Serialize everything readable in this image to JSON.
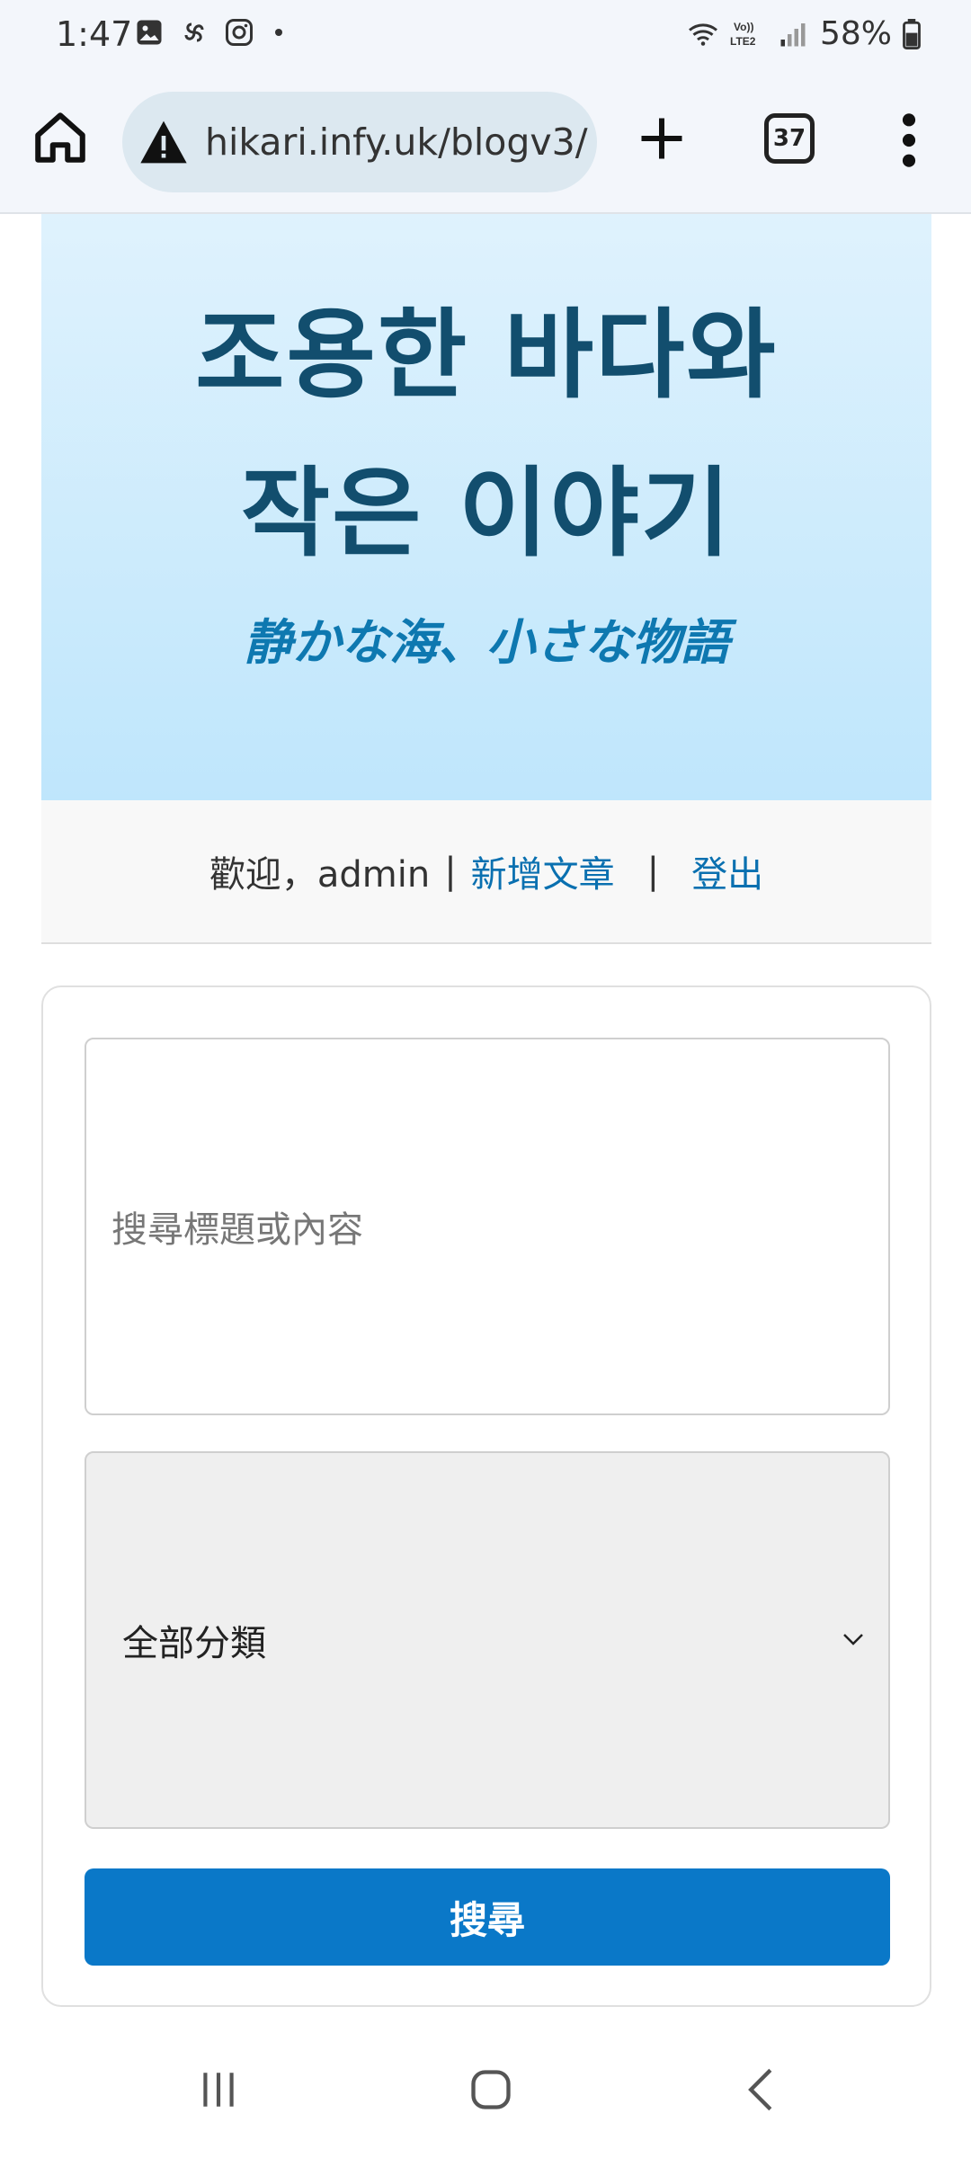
{
  "status_bar": {
    "time": "1:47",
    "battery": "58%",
    "left_icons": [
      "gallery-icon",
      "pinwheel-icon",
      "instagram-icon",
      "dot-icon"
    ],
    "right_icons": [
      "wifi-icon",
      "volte-icon",
      "signal-icon",
      "battery-icon"
    ],
    "volte_text": "Vo)) LTE2"
  },
  "browser": {
    "url": "hikari.infy.uk/blogv3/",
    "tab_count": "37"
  },
  "hero": {
    "title_line1": "조용한 바다와",
    "title_line2": "작은 이야기",
    "subtitle": "静かな海、小さな物語"
  },
  "user_bar": {
    "welcome": "歡迎，admin",
    "separator": "|",
    "new_post": "新增文章",
    "logout": "登出"
  },
  "search": {
    "placeholder": "搜尋標題或內容",
    "category_selected": "全部分類",
    "button_label": "搜尋"
  },
  "colors": {
    "hero_title": "#124e6e",
    "hero_subtitle": "#0e78b0",
    "link": "#0a70b0",
    "button": "#0a78c8"
  }
}
